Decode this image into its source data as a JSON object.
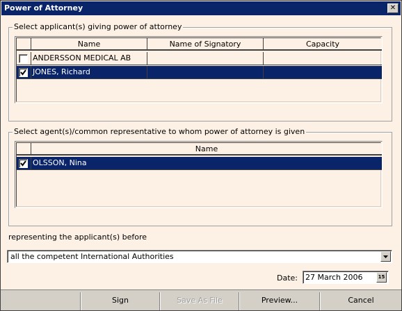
{
  "window": {
    "title": "Power of Attorney"
  },
  "applicants": {
    "legend": "Select applicant(s) giving power of attorney",
    "columns": [
      "Name",
      "Name of Signatory",
      "Capacity"
    ],
    "rows": [
      {
        "checked": false,
        "name": "ANDERSSON MEDICAL AB",
        "signatory": "",
        "capacity": ""
      },
      {
        "checked": true,
        "name": "JONES, Richard",
        "signatory": "",
        "capacity": ""
      }
    ]
  },
  "agents": {
    "legend": "Select agent(s)/common representative to whom power of attorney is given",
    "columns": [
      "Name"
    ],
    "rows": [
      {
        "checked": true,
        "name": "OLSSON, Nina"
      }
    ]
  },
  "representing": {
    "label": "representing the applicant(s) before",
    "selected": "all the competent International Authorities"
  },
  "date": {
    "label": "Date:",
    "value": "27 March 2006",
    "button_text": "15"
  },
  "buttons": {
    "sign": "Sign",
    "save_as_file": "Save As File",
    "preview": "Preview...",
    "cancel": "Cancel"
  },
  "colors": {
    "selection": "#0a246a",
    "background": "#fdf1e5",
    "chrome": "#d4d0c8"
  }
}
